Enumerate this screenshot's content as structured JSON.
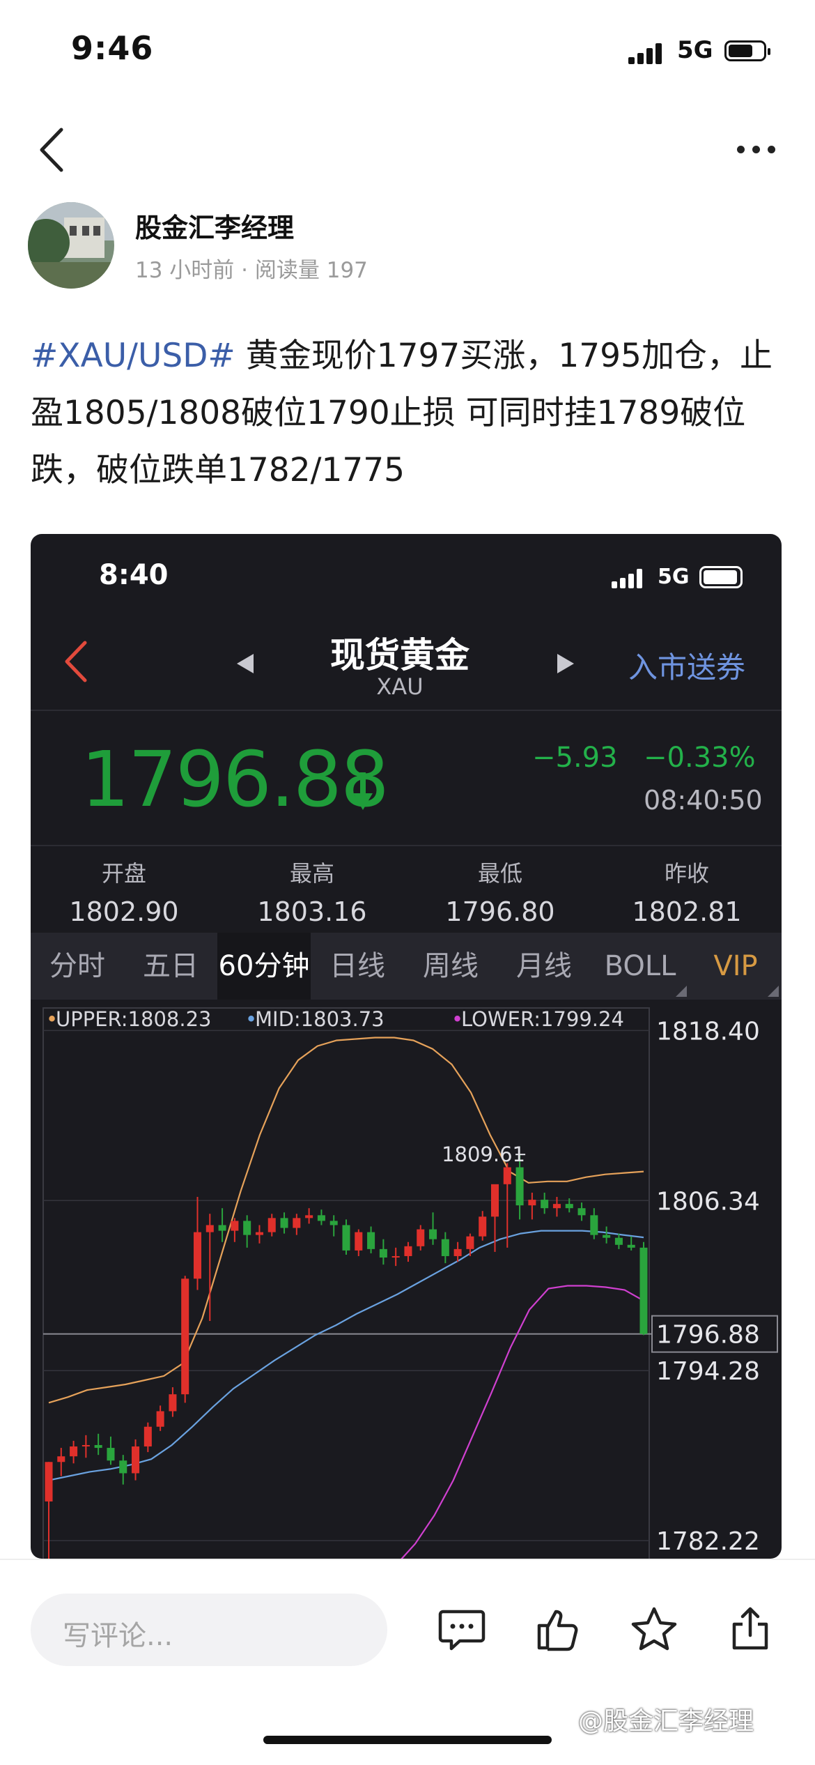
{
  "status_bar": {
    "time": "9:46",
    "network": "5G"
  },
  "post": {
    "author": "股金汇李经理",
    "meta": "13 小时前 · 阅读量 197",
    "hashtag": "#XAU/USD#",
    "body": " 黄金现价1797买涨，1795加仓，止盈1805/1808破位1790止损 可同时挂1789破位跌，破位跌单1782/1775"
  },
  "embed": {
    "status_time": "8:40",
    "network": "5G",
    "title": "现货黄金",
    "subtitle": "XAU",
    "promo": "入市送券",
    "price": "1796.88",
    "change": "−5.93",
    "change_pct": "−0.33%",
    "clock": "08:40:50",
    "stats": [
      {
        "label": "开盘",
        "value": "1802.90"
      },
      {
        "label": "最高",
        "value": "1803.16"
      },
      {
        "label": "最低",
        "value": "1796.80"
      },
      {
        "label": "昨收",
        "value": "1802.81"
      }
    ],
    "tabs": [
      "分时",
      "五日",
      "60分钟",
      "日线",
      "周线",
      "月线",
      "BOLL",
      "VIP"
    ],
    "active_tab": "60分钟",
    "colors": {
      "up": "#e0302b",
      "down": "#2aa43d",
      "upper": "#e6a25a",
      "mid": "#6aa2e0",
      "lower": "#d040d0"
    }
  },
  "chart_data": {
    "type": "candlestick",
    "legend": {
      "upper": "UPPER:1808.23",
      "mid": "MID:1803.73",
      "lower": "LOWER:1799.24"
    },
    "y_ticks": [
      "1818.40",
      "1806.34",
      "1796.88",
      "1794.28",
      "1782.22"
    ],
    "ylim": [
      1780.2,
      1820.0
    ],
    "last_price": 1796.88,
    "high_label": "1809.61",
    "candles": [
      [
        1785.0,
        1787.8,
        1779.0,
        1787.8
      ],
      [
        1787.8,
        1788.8,
        1786.8,
        1788.2
      ],
      [
        1788.2,
        1789.3,
        1787.7,
        1788.9
      ],
      [
        1788.9,
        1789.7,
        1788.1,
        1789.0
      ],
      [
        1789.0,
        1789.8,
        1788.3,
        1788.8
      ],
      [
        1788.8,
        1789.6,
        1787.6,
        1787.9
      ],
      [
        1787.9,
        1788.3,
        1786.2,
        1787.0
      ],
      [
        1787.0,
        1789.4,
        1786.5,
        1788.9
      ],
      [
        1788.9,
        1790.6,
        1788.5,
        1790.3
      ],
      [
        1790.3,
        1791.8,
        1790.0,
        1791.4
      ],
      [
        1791.4,
        1793.1,
        1791.0,
        1792.6
      ],
      [
        1792.6,
        1801.0,
        1792.0,
        1800.8
      ],
      [
        1800.8,
        1806.6,
        1800.0,
        1804.1
      ],
      [
        1804.1,
        1805.4,
        1797.8,
        1804.6
      ],
      [
        1804.6,
        1805.8,
        1803.4,
        1804.2
      ],
      [
        1804.2,
        1805.1,
        1803.4,
        1804.9
      ],
      [
        1804.9,
        1805.3,
        1803.0,
        1803.9
      ],
      [
        1803.9,
        1804.6,
        1803.3,
        1804.1
      ],
      [
        1804.1,
        1805.4,
        1803.8,
        1805.1
      ],
      [
        1805.1,
        1805.5,
        1804.0,
        1804.4
      ],
      [
        1804.4,
        1805.4,
        1803.9,
        1805.1
      ],
      [
        1805.1,
        1805.8,
        1804.7,
        1805.3
      ],
      [
        1805.3,
        1805.7,
        1804.6,
        1804.9
      ],
      [
        1804.9,
        1805.3,
        1803.8,
        1804.6
      ],
      [
        1804.6,
        1805.0,
        1802.5,
        1802.8
      ],
      [
        1802.8,
        1804.3,
        1802.4,
        1804.1
      ],
      [
        1804.1,
        1804.5,
        1802.6,
        1802.9
      ],
      [
        1802.9,
        1803.6,
        1801.8,
        1802.3
      ],
      [
        1802.3,
        1803.0,
        1801.7,
        1802.4
      ],
      [
        1802.4,
        1803.4,
        1802.0,
        1803.1
      ],
      [
        1803.1,
        1804.6,
        1802.8,
        1804.3
      ],
      [
        1804.3,
        1805.5,
        1803.2,
        1803.6
      ],
      [
        1803.6,
        1804.1,
        1801.9,
        1802.4
      ],
      [
        1802.4,
        1803.4,
        1802.0,
        1802.9
      ],
      [
        1802.9,
        1804.0,
        1802.4,
        1803.8
      ],
      [
        1803.8,
        1805.6,
        1803.5,
        1805.2
      ],
      [
        1805.2,
        1806.8,
        1802.7,
        1807.5
      ],
      [
        1807.5,
        1809.0,
        1803.0,
        1808.7
      ],
      [
        1808.7,
        1809.61,
        1805.0,
        1806.0
      ],
      [
        1806.0,
        1806.9,
        1805.0,
        1806.4
      ],
      [
        1806.4,
        1806.9,
        1805.4,
        1805.8
      ],
      [
        1805.8,
        1806.6,
        1805.2,
        1806.1
      ],
      [
        1806.1,
        1806.5,
        1805.5,
        1805.8
      ],
      [
        1805.8,
        1806.2,
        1804.9,
        1805.3
      ],
      [
        1805.3,
        1805.8,
        1803.6,
        1803.9
      ],
      [
        1803.9,
        1804.5,
        1803.3,
        1803.7
      ],
      [
        1803.7,
        1804.0,
        1802.9,
        1803.2
      ],
      [
        1803.2,
        1803.8,
        1802.8,
        1803.0
      ],
      [
        1803.0,
        1803.4,
        1796.8,
        1796.88
      ]
    ],
    "upper_band": [
      1792.0,
      1792.4,
      1792.9,
      1793.1,
      1793.3,
      1793.6,
      1793.9,
      1794.8,
      1798.0,
      1802.5,
      1807.0,
      1811.0,
      1814.3,
      1816.3,
      1817.3,
      1817.7,
      1817.8,
      1817.9,
      1817.9,
      1817.7,
      1817.1,
      1816.0,
      1814.0,
      1811.0,
      1808.4,
      1807.6,
      1807.7,
      1807.7,
      1808.0,
      1808.2,
      1808.3,
      1808.4
    ],
    "mid_band": [
      1786.5,
      1786.8,
      1787.1,
      1787.3,
      1787.6,
      1788.0,
      1789.0,
      1790.3,
      1791.7,
      1793.0,
      1794.0,
      1795.0,
      1795.9,
      1796.8,
      1797.5,
      1798.3,
      1799.0,
      1799.7,
      1800.5,
      1801.3,
      1802.1,
      1803.0,
      1803.6,
      1804.0,
      1804.2,
      1804.2,
      1804.2,
      1804.1,
      1803.9,
      1803.73
    ],
    "lower_band": [
      1778.0,
      1779.0,
      1780.5,
      1782.0,
      1784.0,
      1786.5,
      1789.6,
      1792.7,
      1795.9,
      1798.6,
      1800.1,
      1800.3,
      1800.3,
      1800.2,
      1800.0,
      1799.24
    ]
  },
  "bottom_bar": {
    "comment_placeholder": "写评论...",
    "watermark": "@股金汇李经理"
  }
}
